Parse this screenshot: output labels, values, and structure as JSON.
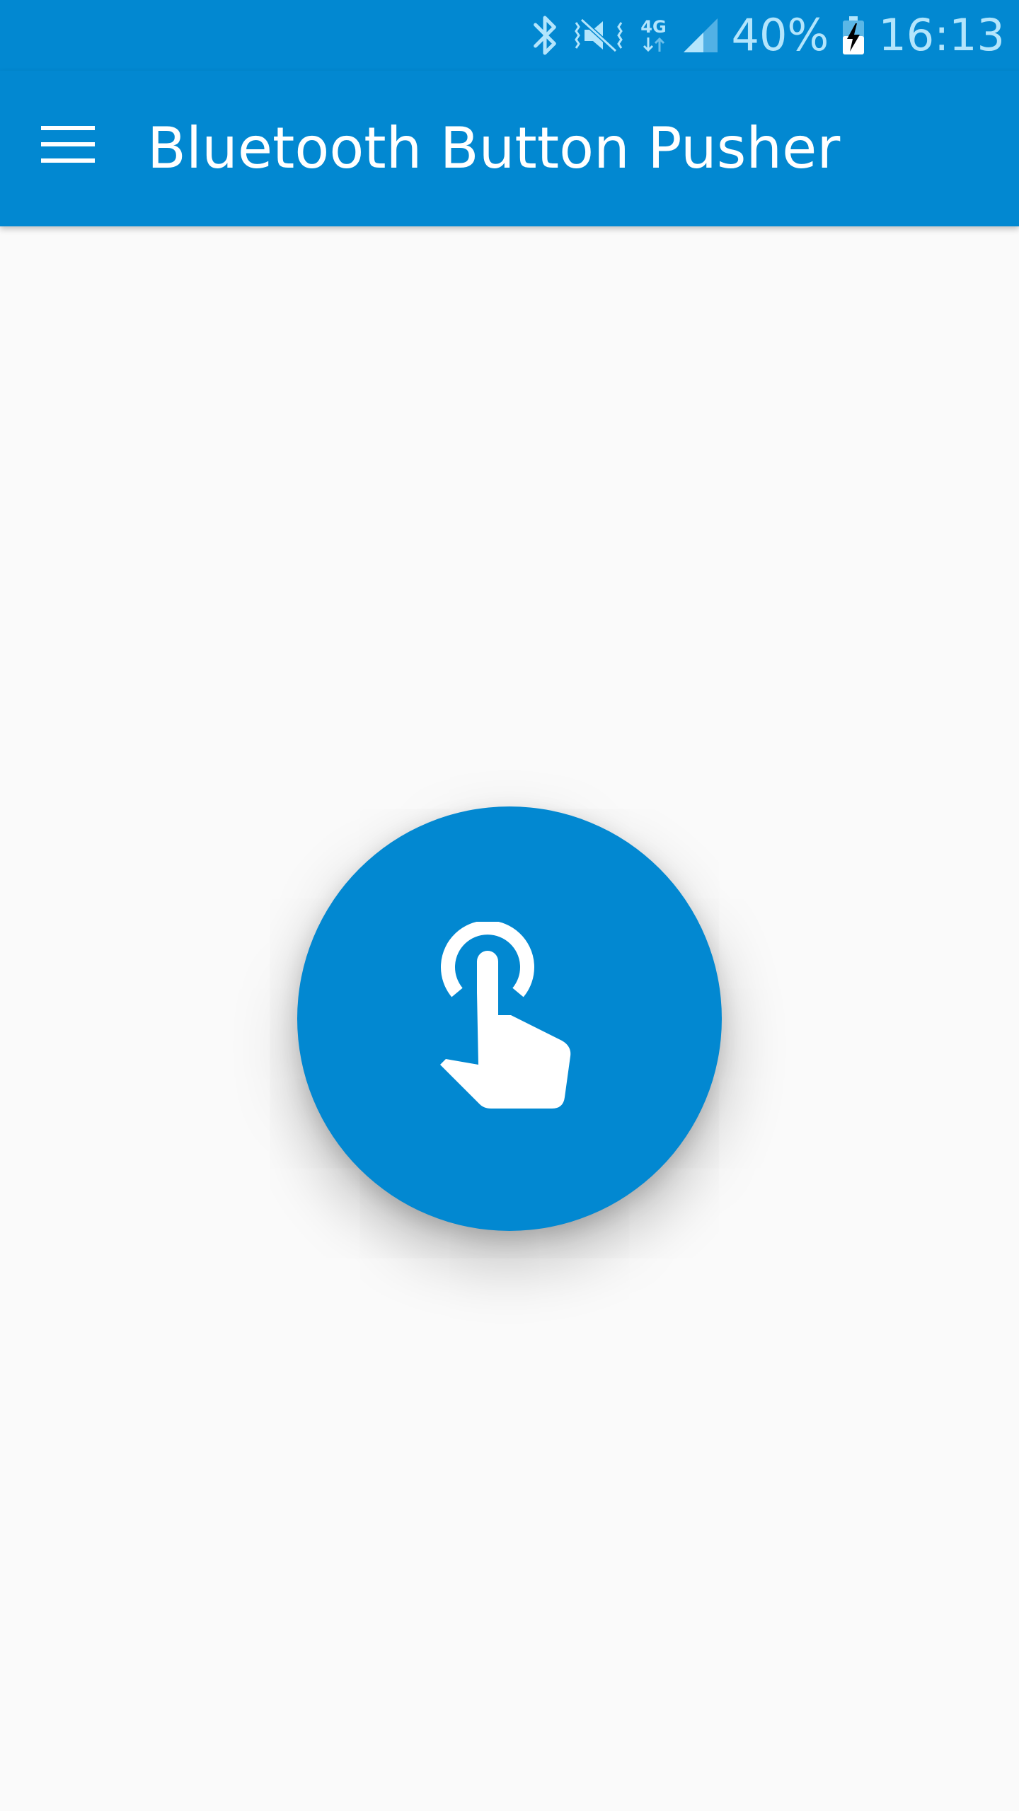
{
  "colors": {
    "primary": "#0288d1",
    "status_icon": "#b3e5fc",
    "background": "#fafafa",
    "on_primary": "#ffffff"
  },
  "status_bar": {
    "icons": [
      "bluetooth-icon",
      "vibrate-mute-icon",
      "network-4g-icon",
      "signal-icon",
      "battery-charging-icon"
    ],
    "network_label": "4G",
    "battery": "40%",
    "time": "16:13"
  },
  "app_bar": {
    "title": "Bluetooth Button Pusher",
    "menu_icon": "hamburger-menu-icon"
  },
  "main": {
    "button_icon": "touch-hand-icon"
  }
}
